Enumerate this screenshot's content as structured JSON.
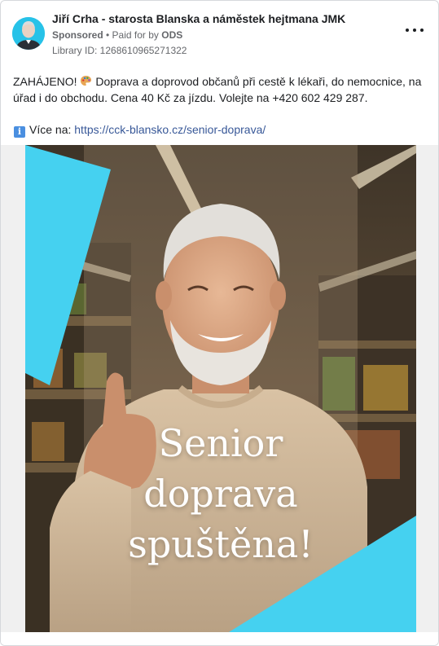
{
  "post": {
    "page_name": "Jiří Crha - starosta Blanska a náměstek hejtmana JMK",
    "sponsored_label": "Sponsored",
    "separator": " • ",
    "paid_for_prefix": "Paid for by ",
    "paid_for_by": "ODS",
    "library_id": "Library ID: 1268610965271322",
    "more_icon": "more-horizontal-icon",
    "avatar_color": "#27c2e8"
  },
  "body": {
    "text_before_emoji": "ZAHÁJENO! ",
    "emoji": "palette-icon",
    "text_after_emoji": " Doprava a doprovod občanů při cestě k lékaři, do nemocnice, na úřad i do obchodu. Cena 40 Kč za jízdu. Volejte na +420 602 429 287.",
    "info_icon": "info-icon",
    "more_label": "Více na: ",
    "link_text": "https://cck-blansko.cz/senior-doprava/"
  },
  "ad_image": {
    "line1": "Senior",
    "line2": "doprava",
    "line3": "spuštěna!",
    "accent_color": "#45d1f0"
  }
}
